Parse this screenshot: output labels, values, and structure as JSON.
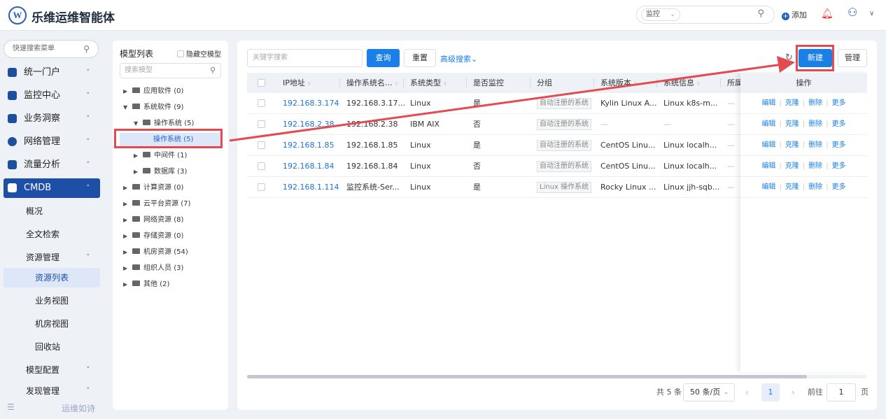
{
  "app": {
    "title": "乐维运维智能体",
    "logo_letter": "W"
  },
  "header": {
    "search_scope": "监控",
    "add_label": "添加"
  },
  "sidebar": {
    "search_placeholder": "快速搜索菜单",
    "menus": [
      {
        "label": "统一门户"
      },
      {
        "label": "监控中心"
      },
      {
        "label": "业务洞察"
      },
      {
        "label": "网络管理"
      },
      {
        "label": "流量分析"
      },
      {
        "label": "CMDB"
      }
    ],
    "cmdb_children": [
      {
        "label": "概况"
      },
      {
        "label": "全文检索"
      },
      {
        "label": "资源管理"
      },
      {
        "label": "资源列表"
      },
      {
        "label": "业务视图"
      },
      {
        "label": "机房视图"
      },
      {
        "label": "回收站"
      },
      {
        "label": "模型配置"
      },
      {
        "label": "发现管理"
      }
    ],
    "footer_text": "运维如诗"
  },
  "tree": {
    "title": "模型列表",
    "hide_empty_label": "隐藏空模型",
    "search_placeholder": "搜索模型",
    "nodes": [
      {
        "label": "应用软件",
        "count": "(0)"
      },
      {
        "label": "系统软件",
        "count": "(9)"
      },
      {
        "label": "操作系统",
        "count": "(5)"
      },
      {
        "label": "操作系统",
        "count": "(5)"
      },
      {
        "label": "中间件",
        "count": "(1)"
      },
      {
        "label": "数据库",
        "count": "(3)"
      },
      {
        "label": "计算资源",
        "count": "(0)"
      },
      {
        "label": "云平台资源",
        "count": "(7)"
      },
      {
        "label": "网络资源",
        "count": "(8)"
      },
      {
        "label": "存储资源",
        "count": "(0)"
      },
      {
        "label": "机房资源",
        "count": "(54)"
      },
      {
        "label": "组织人员",
        "count": "(3)"
      },
      {
        "label": "其他",
        "count": "(2)"
      }
    ]
  },
  "toolbar": {
    "keyword_placeholder": "关键字搜索",
    "query_label": "查询",
    "reset_label": "重置",
    "advanced_label": "高级搜索",
    "new_label": "新建",
    "manage_label": "管理"
  },
  "table": {
    "columns": [
      "IP地址",
      "操作系统名...",
      "系统类型",
      "是否监控",
      "分组",
      "系统版本",
      "系统信息",
      "所属"
    ],
    "action_header": "操作",
    "actions": [
      "编辑",
      "克隆",
      "删除",
      "更多"
    ],
    "rows": [
      {
        "ip": "192.168.3.174",
        "name": "192.168.3.17...",
        "type": "Linux",
        "monitored": "是",
        "group": "自动注册的系统",
        "version": "Kylin Linux A...",
        "info": "Linux k8s-m...",
        "owner": "—"
      },
      {
        "ip": "192.168.2.38",
        "name": "192.168.2.38",
        "type": "IBM AIX",
        "monitored": "否",
        "group": "自动注册的系统",
        "version": "—",
        "info": "—",
        "owner": "—"
      },
      {
        "ip": "192.168.1.85",
        "name": "192.168.1.85",
        "type": "Linux",
        "monitored": "是",
        "group": "自动注册的系统",
        "version": "CentOS Linu...",
        "info": "Linux localh...",
        "owner": "—"
      },
      {
        "ip": "192.168.1.84",
        "name": "192.168.1.84",
        "type": "Linux",
        "monitored": "否",
        "group": "自动注册的系统",
        "version": "CentOS Linu...",
        "info": "Linux localh...",
        "owner": "—"
      },
      {
        "ip": "192.168.1.114",
        "name": "监控系统-Ser...",
        "type": "Linux",
        "monitored": "是",
        "group": "Linux 操作系统",
        "version": "Rocky Linux ...",
        "info": "Linux jjh-sqb...",
        "owner": "—"
      }
    ]
  },
  "pagination": {
    "total_text": "共 5 条",
    "page_size": "50 条/页",
    "current_page": "1",
    "goto_label": "前往",
    "goto_value": "1",
    "page_unit": "页"
  },
  "colors": {
    "accent": "#1a7fe6",
    "highlight": "#e24b52",
    "nav_active": "#1d4fa6"
  }
}
